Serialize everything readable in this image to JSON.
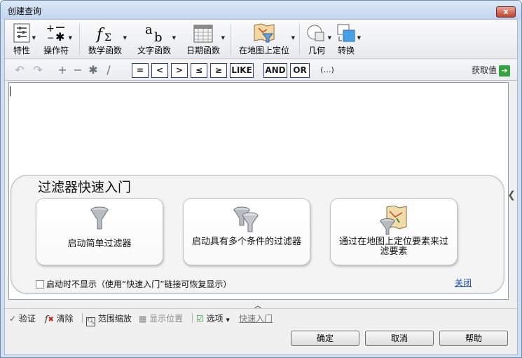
{
  "window": {
    "title": "创建查询",
    "close_symbol": "x"
  },
  "ribbon": {
    "properties": "特性",
    "operators": "操作符",
    "math_functions": "数学函数",
    "text_functions": "文字函数",
    "date_functions": "日期函数",
    "locate_on_map": "在地图上定位",
    "geometry": "几何",
    "convert": "转换"
  },
  "operators": {
    "equal": "=",
    "less": "<",
    "greater": ">",
    "less_equal": "≤",
    "greater_equal": "≥",
    "like": "LIKE",
    "and": "AND",
    "or": "OR",
    "parens": "(…)",
    "get_values": "获取值"
  },
  "quick_start": {
    "title": "过滤器快速入门",
    "card1": "启动简单过滤器",
    "card2": "启动具有多个条件的过滤器",
    "card3": "通过在地图上定位要素来过滤要素",
    "dont_show": "启动时不显示（使用“快速入门”链接可恢复显示）",
    "close": "关闭"
  },
  "statusbar": {
    "validate": "验证",
    "clear": "清除",
    "zoom_extent": "范围缩放",
    "show_position": "显示位置",
    "options": "选项",
    "quick_start_link": "快速入门"
  },
  "buttons": {
    "ok": "确定",
    "cancel": "取消",
    "help": "帮助"
  }
}
